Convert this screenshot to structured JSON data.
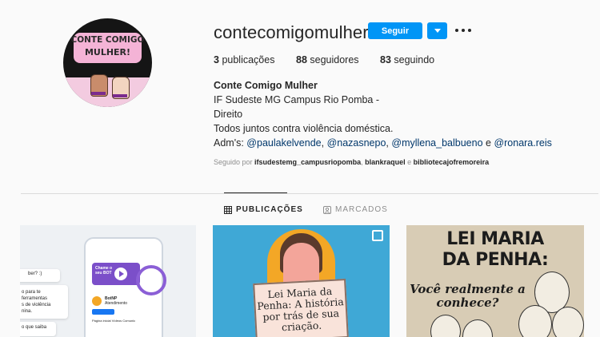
{
  "avatar": {
    "line1": "CONTE COMIGO",
    "line2": "MULHER!"
  },
  "profile": {
    "username": "contecomigomulher",
    "follow_label": "Seguir",
    "stats": {
      "posts_count": "3",
      "posts_label": "publicações",
      "followers_count": "88",
      "followers_label": "seguidores",
      "following_count": "83",
      "following_label": "seguindo"
    },
    "name": "Conte Comigo Mulher",
    "bio_lines": [
      "IF Sudeste MG Campus Rio Pomba -",
      "Direito",
      "Todos juntos contra violência doméstica."
    ],
    "adms": {
      "prefix": "Adm's: ",
      "handles": [
        "@paulakelvende",
        "@nazasnepo",
        "@myllena_balbueno",
        "@ronara.reis"
      ],
      "sep": ", ",
      "and": " e "
    },
    "followed_by": {
      "prefix": "Seguido por ",
      "users": [
        "ifsudestemg_campusriopomba",
        "blankraquel",
        "bibliotecajofremoreira"
      ],
      "sep": ", ",
      "and": " e "
    }
  },
  "tabs": {
    "posts": "PUBLICAÇÕES",
    "tagged": "MARCADOS"
  },
  "posts": [
    {
      "side_texts": [
        "ber? :)",
        "o para te",
        "ferramentas",
        "s de violência",
        "nina.",
        "o que saiba"
      ],
      "phone_labels": [
        "Chame o",
        "seu BOT",
        "BotNP",
        "Atendimento",
        "Página inicial",
        "Vídeos",
        "Comunic"
      ]
    },
    {
      "sign_lines": [
        "Lei Maria da",
        "Penha: A história",
        "por trás de sua",
        "criação."
      ]
    },
    {
      "title_lines": [
        "LEI MARIA",
        "DA PENHA:"
      ],
      "sub_lines": [
        "Você realmente a",
        "conhece?"
      ]
    }
  ],
  "colors": {
    "accent": "#0095f6",
    "link": "#00376b"
  }
}
